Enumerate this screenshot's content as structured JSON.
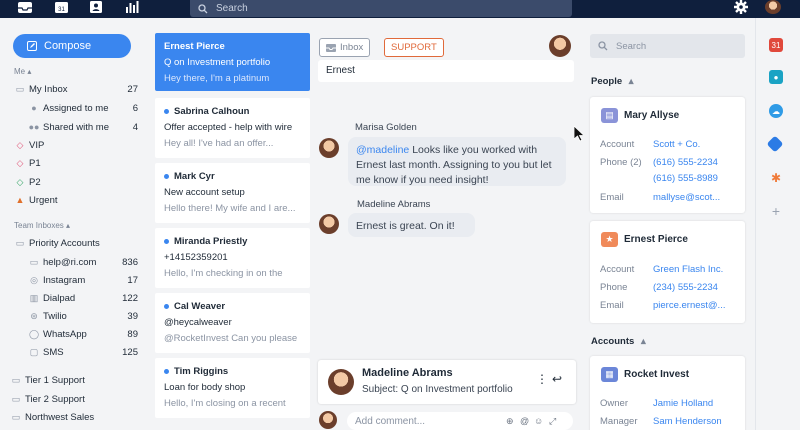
{
  "topbar": {
    "search_placeholder": "Search",
    "calendar_day": "31"
  },
  "sidebar": {
    "compose_label": "Compose",
    "me_label": "Me",
    "me_items": [
      {
        "label": "My Inbox",
        "count": "27"
      },
      {
        "label": "Assigned to me",
        "count": "6"
      },
      {
        "label": "Shared with me",
        "count": "4"
      }
    ],
    "tags": [
      {
        "label": "VIP",
        "color": "#e05a7a"
      },
      {
        "label": "P1",
        "color": "#e05a7a"
      },
      {
        "label": "P2",
        "color": "#3aa86a"
      },
      {
        "label": "Urgent",
        "color": "#e0702b"
      }
    ],
    "team_label": "Team Inboxes",
    "priority_accounts": "Priority Accounts",
    "channels": [
      {
        "label": "help@ri.com",
        "count": "836"
      },
      {
        "label": "Instagram",
        "count": "17"
      },
      {
        "label": "Dialpad",
        "count": "122"
      },
      {
        "label": "Twilio",
        "count": "39"
      },
      {
        "label": "WhatsApp",
        "count": "89"
      },
      {
        "label": "SMS",
        "count": "125"
      }
    ],
    "tiers": [
      "Tier 1 Support",
      "Tier 2 Support",
      "Northwest Sales"
    ]
  },
  "conversations": [
    {
      "name": "Ernest Pierce",
      "subject": "Q on Investment portfolio",
      "preview": "Hey there, I'm a platinum",
      "unread": false
    },
    {
      "name": "Sabrina Calhoun",
      "subject": "Offer accepted - help with wire",
      "preview": "Hey all! I've had an offer...",
      "unread": true
    },
    {
      "name": "Mark Cyr",
      "subject": "New account setup",
      "preview": "Hello there! My wife and I are...",
      "unread": true
    },
    {
      "name": "Miranda Priestly",
      "subject": "+14152359201",
      "preview": "Hello, I'm checking in on the",
      "unread": true
    },
    {
      "name": "Cal Weaver",
      "subject": "@heycalweaver",
      "preview": "@RocketInvest Can you please",
      "unread": true
    },
    {
      "name": "Tim Riggins",
      "subject": "Loan for body shop",
      "preview": "Hello, I'm closing on a recent",
      "unread": true
    }
  ],
  "thread": {
    "inbox_tag": "Inbox",
    "support_tag": "SUPPORT",
    "card_text": "Ernest",
    "comments": [
      {
        "author": "Marisa Golden",
        "mention": "@madeline",
        "text": " Looks like you worked with Ernest last month. Assigning to you but let me know if you need insight!"
      },
      {
        "author": "Madeline Abrams",
        "mention": "",
        "text": "Ernest is great. On it!"
      }
    ],
    "reply_name": "Madeline Abrams",
    "reply_subject_label": "Subject:",
    "reply_subject": "Q on Investment portfolio",
    "comment_placeholder": "Add comment..."
  },
  "contact_panel": {
    "search_placeholder": "Search",
    "people_label": "People",
    "accounts_label": "Accounts",
    "people": [
      {
        "name": "Mary Allyse",
        "rows": [
          {
            "key": "Account",
            "value": "Scott + Co."
          },
          {
            "key": "Phone (2)",
            "value": "(616) 555-2234"
          },
          {
            "key": "",
            "value": "(616) 555-8989"
          },
          {
            "key": "Email",
            "value": "mallyse@scot..."
          }
        ]
      },
      {
        "name": "Ernest Pierce",
        "rows": [
          {
            "key": "Account",
            "value": "Green Flash Inc."
          },
          {
            "key": "Phone",
            "value": "(234) 555-2234"
          },
          {
            "key": "Email",
            "value": "pierce.ernest@..."
          }
        ]
      }
    ],
    "account": {
      "name": "Rocket Invest",
      "rows": [
        {
          "key": "Owner",
          "value": "Jamie Holland"
        },
        {
          "key": "Manager",
          "value": "Sam Henderson"
        }
      ]
    }
  },
  "colors": {
    "accent": "#3a86ef",
    "topbar": "#0f1f3d",
    "support": "#e06a3b"
  }
}
